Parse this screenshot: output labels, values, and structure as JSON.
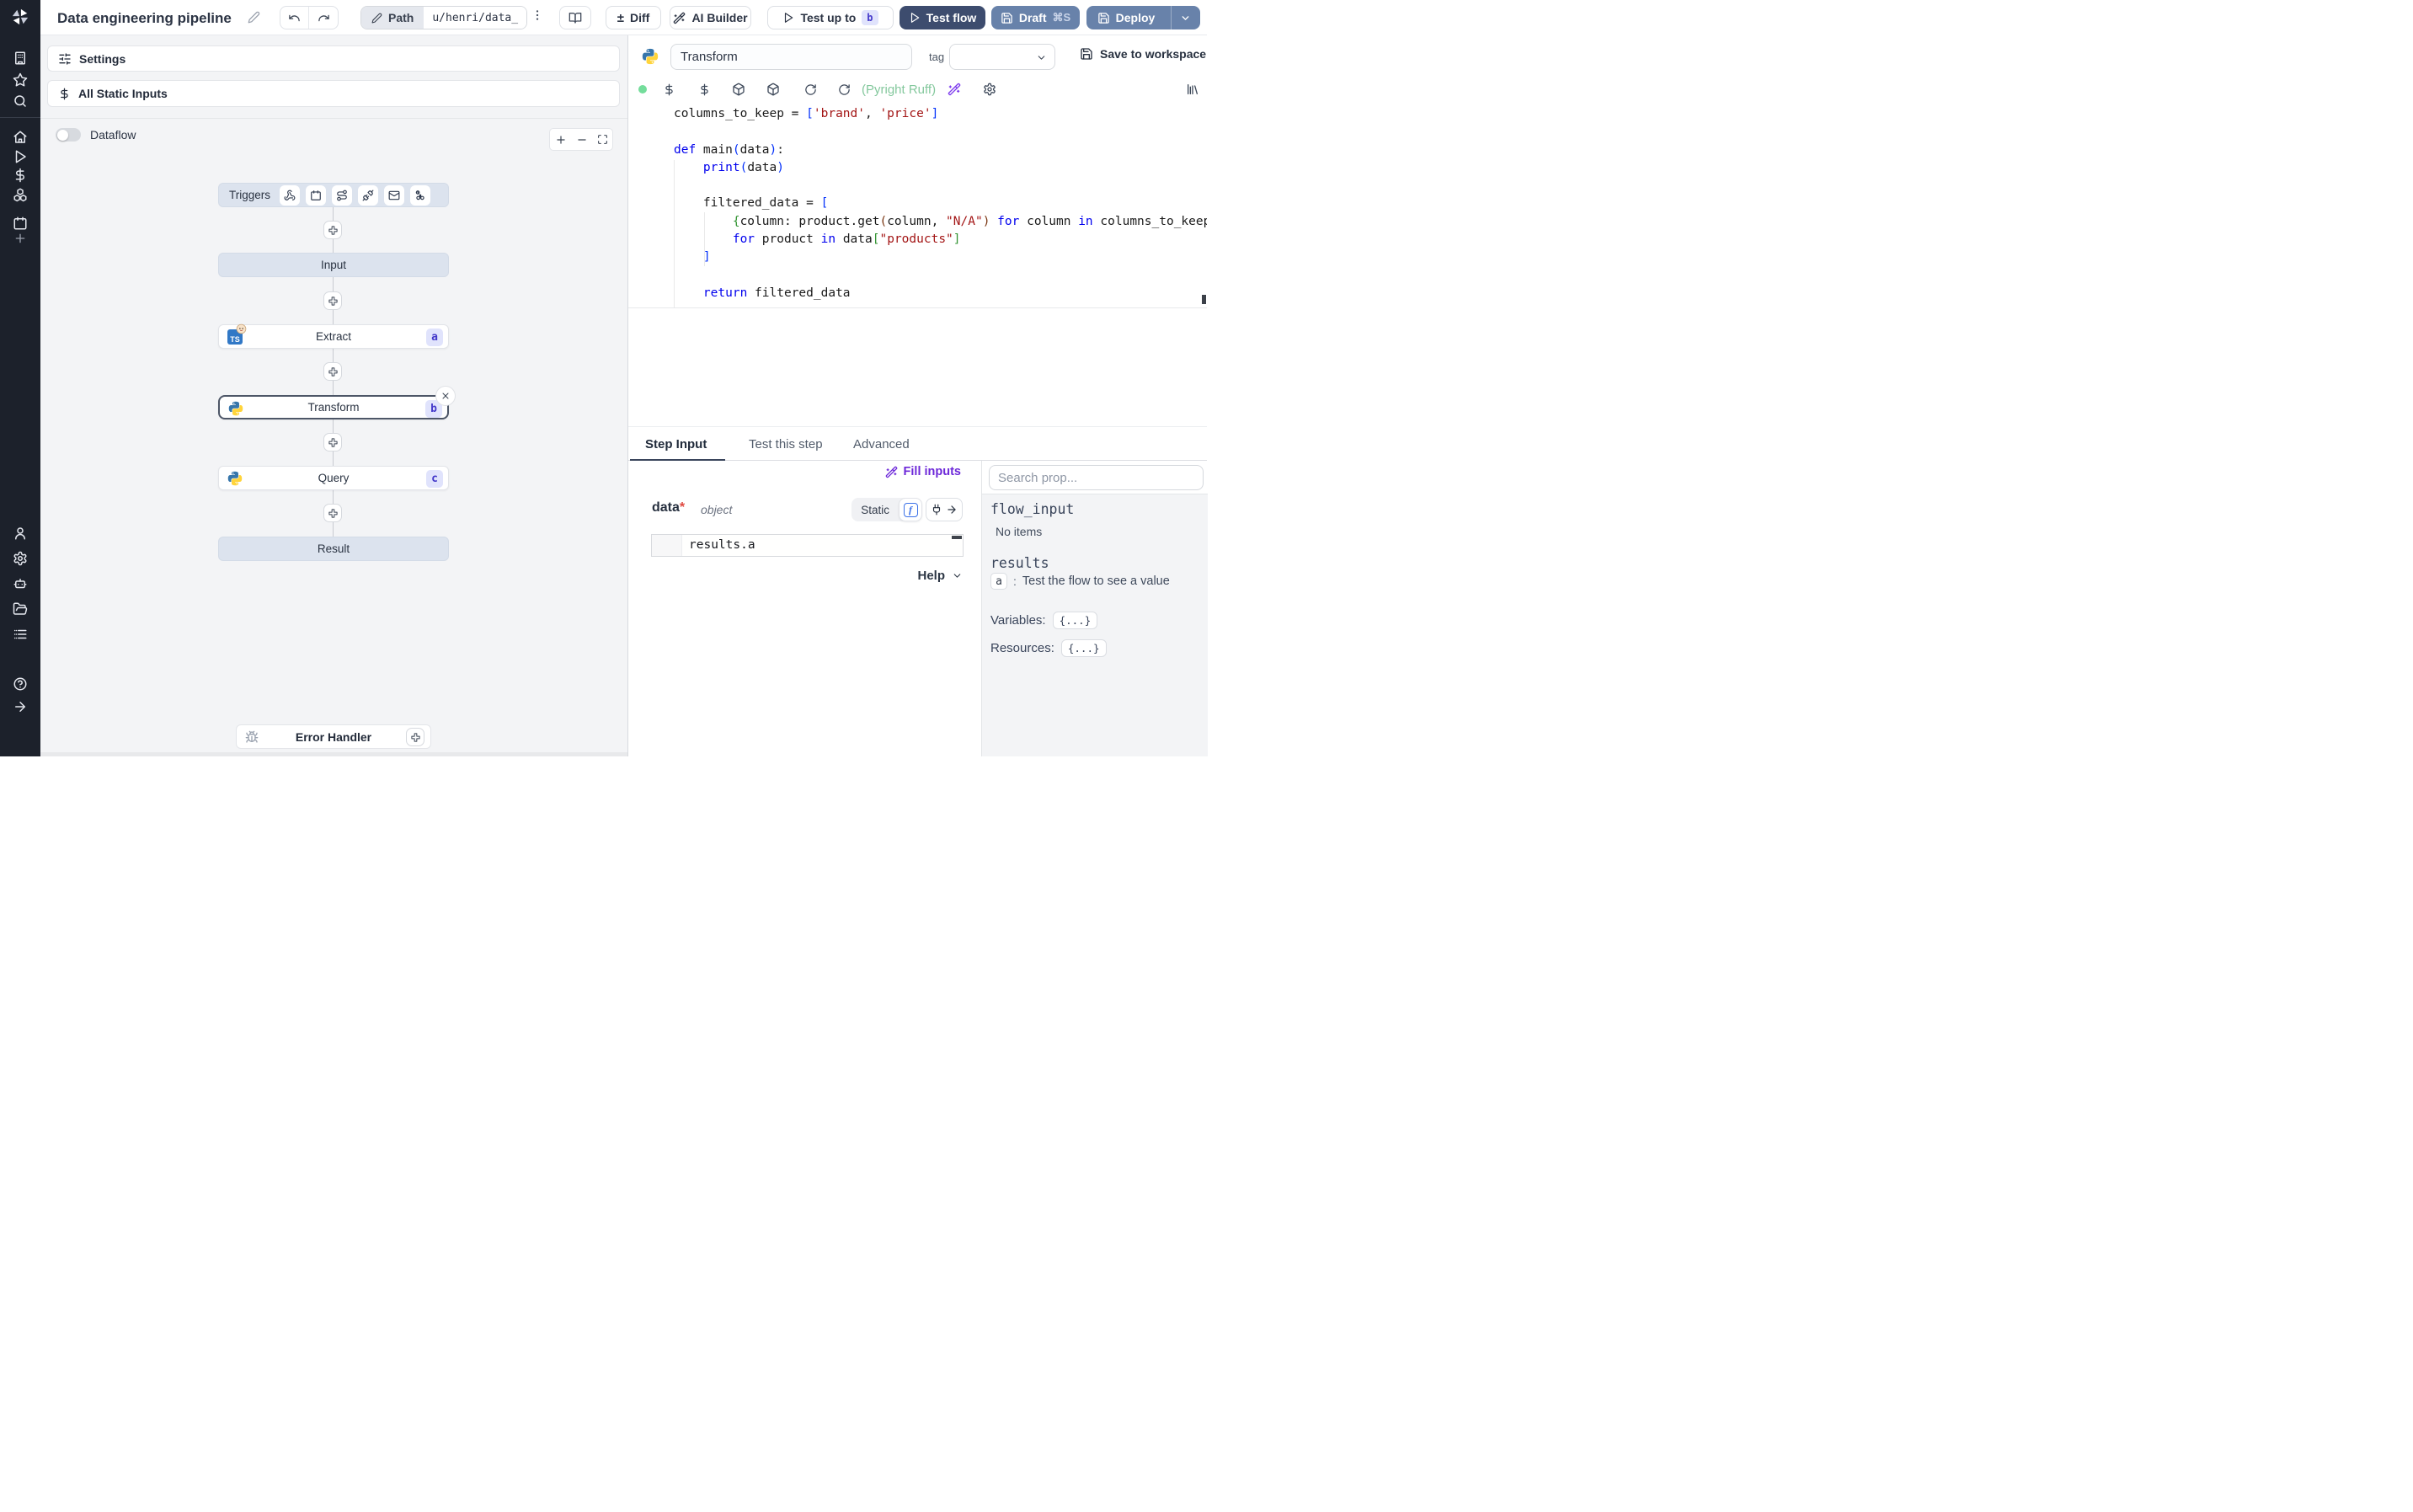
{
  "colors": {
    "accent_purple": "#6d28d9",
    "primary_dark_button": "#3d4c6e",
    "steel_button": "#6882aa",
    "badge_bg": "#e0e3fc",
    "badge_text": "#4338ca",
    "lint_green": "#84c89d",
    "selected_node_border": "#4d5667",
    "rail_bg": "#1c212b",
    "canvas_bg": "#f3f4f6",
    "status_dot_green": "#74dd9b"
  },
  "topbar": {
    "title": "Data engineering pipeline",
    "diff_glyph": "±",
    "diff": "Diff",
    "ai_builder": "AI Builder",
    "test_up_to": "Test up to",
    "test_up_to_badge": "b",
    "test_flow": "Test flow",
    "draft": "Draft",
    "draft_shortcut": "⌘S",
    "deploy": "Deploy",
    "path_label": "Path",
    "path_value": "u/henri/data_"
  },
  "sidebar": {
    "icons": [
      "windmill-logo",
      "workspace-icon",
      "favorites-icon",
      "search-icon",
      "home-icon",
      "runs-icon",
      "variables-icon",
      "resources-icon",
      "schedules-icon",
      "add-icon",
      "user-icon",
      "settings-icon",
      "workers-icon",
      "folders-icon",
      "audit-logs-icon",
      "help-icon",
      "collapse-icon"
    ]
  },
  "flow_panel": {
    "settings": "Settings",
    "all_static_inputs": "All Static Inputs",
    "dataflow": "Dataflow",
    "zoom_icons": [
      "zoom-in-icon",
      "zoom-out-icon",
      "fit-view-icon"
    ]
  },
  "graph": {
    "triggers_label": "Triggers",
    "trigger_icons": [
      "webhook-icon",
      "schedule-icon",
      "route-icon",
      "websocket-icon",
      "email-icon",
      "poll-icon"
    ],
    "nodes": [
      {
        "label": "Input"
      },
      {
        "label": "Extract",
        "badge": "a",
        "language": "bun"
      },
      {
        "label": "Transform",
        "badge": "b",
        "language": "python",
        "selected": true
      },
      {
        "label": "Query",
        "badge": "c",
        "language": "python"
      },
      {
        "label": "Result"
      }
    ],
    "error_handler_label": "Error Handler"
  },
  "editor": {
    "step_name": "Transform",
    "tag_label": "tag",
    "save_button": "Save to workspace",
    "lint_status": "(Pyright Ruff)",
    "code_lines": [
      [
        [
          "t",
          "columns_to_keep = "
        ],
        [
          "b1",
          "["
        ],
        [
          "s",
          "'brand'"
        ],
        [
          "t",
          ", "
        ],
        [
          "s",
          "'price'"
        ],
        [
          "b1",
          "]"
        ]
      ],
      [],
      [
        [
          "k",
          "def "
        ],
        [
          "t",
          "main"
        ],
        [
          "b1",
          "("
        ],
        [
          "t",
          "data"
        ],
        [
          "b1",
          ")"
        ],
        [
          "t",
          ":"
        ]
      ],
      [
        [
          "t",
          "    "
        ],
        [
          "k",
          "print"
        ],
        [
          "b1",
          "("
        ],
        [
          "t",
          "data"
        ],
        [
          "b1",
          ")"
        ]
      ],
      [],
      [
        [
          "t",
          "    filtered_data = "
        ],
        [
          "b1",
          "["
        ]
      ],
      [
        [
          "t",
          "        "
        ],
        [
          "b2",
          "{"
        ],
        [
          "t",
          "column: product.get"
        ],
        [
          "b3",
          "("
        ],
        [
          "t",
          "column, "
        ],
        [
          "s",
          "\"N/A\""
        ],
        [
          "b3",
          ")"
        ],
        [
          "t",
          " "
        ],
        [
          "k",
          "for"
        ],
        [
          "t",
          " column "
        ],
        [
          "k",
          "in"
        ],
        [
          "t",
          " columns_to_keep"
        ],
        [
          "b2",
          "}"
        ]
      ],
      [
        [
          "t",
          "        "
        ],
        [
          "k",
          "for"
        ],
        [
          "t",
          " product "
        ],
        [
          "k",
          "in"
        ],
        [
          "t",
          " data"
        ],
        [
          "b2",
          "["
        ],
        [
          "s",
          "\"products\""
        ],
        [
          "b2",
          "]"
        ]
      ],
      [
        [
          "t",
          "    "
        ],
        [
          "b1",
          "]"
        ]
      ],
      [],
      [
        [
          "t",
          "    "
        ],
        [
          "k",
          "return"
        ],
        [
          "t",
          " filtered_data"
        ]
      ]
    ]
  },
  "tabs": {
    "step_input": "Step Input",
    "test_this_step": "Test this step",
    "advanced": "Advanced"
  },
  "step_input": {
    "fill_inputs": "Fill inputs",
    "field_name": "data",
    "required_mark": "*",
    "field_type": "object",
    "static_label": "Static",
    "expression": "results.a",
    "help_label": "Help"
  },
  "props": {
    "search_placeholder": "Search prop...",
    "flow_input_label": "flow_input",
    "flow_input_empty": "No items",
    "results_label": "results",
    "result_key": "a",
    "result_sep": ":",
    "result_hint": "Test the flow to see a value",
    "variables_label": "Variables:",
    "variables_value": "{...}",
    "resources_label": "Resources:",
    "resources_value": "{...}"
  }
}
